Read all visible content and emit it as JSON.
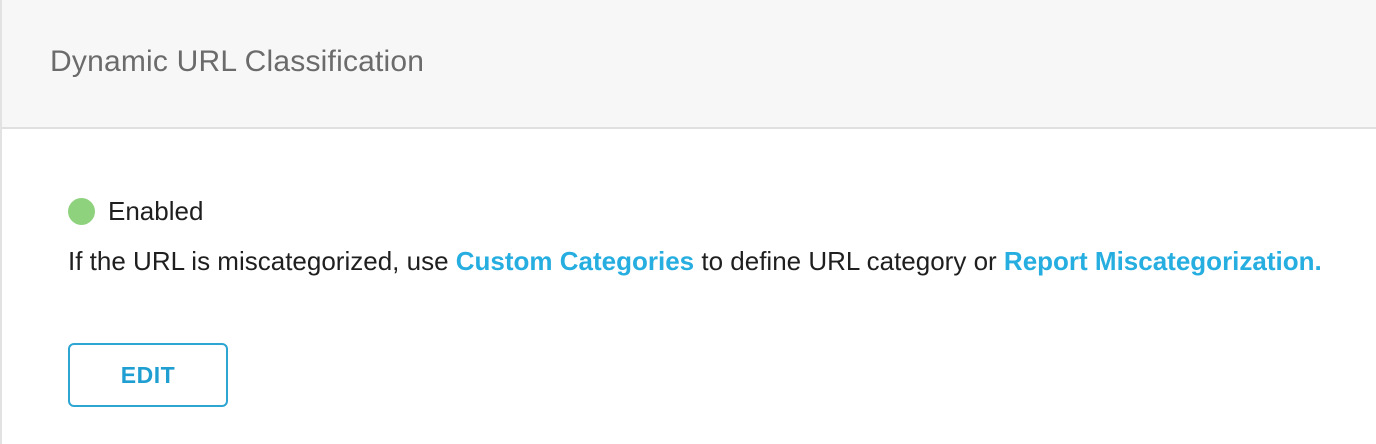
{
  "header": {
    "title": "Dynamic URL Classification"
  },
  "status": {
    "label": "Enabled",
    "color": "#8fd27e"
  },
  "info": {
    "text_before": "If the URL is miscategorized, use ",
    "link_custom_categories": "Custom Categories",
    "text_middle": " to define URL category or ",
    "link_report": "Report Miscategorization.",
    "link_color": "#26aee0"
  },
  "actions": {
    "edit_label": "EDIT",
    "edit_color": "#1f9fd1"
  }
}
